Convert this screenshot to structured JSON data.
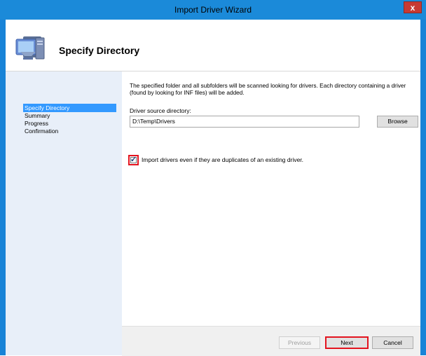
{
  "window": {
    "title": "Import Driver Wizard",
    "close_label": "x"
  },
  "header": {
    "title": "Specify Directory",
    "icon": "computer-monitor-icon"
  },
  "sidebar": {
    "items": [
      {
        "label": "Specify Directory",
        "active": true
      },
      {
        "label": "Summary",
        "active": false
      },
      {
        "label": "Progress",
        "active": false
      },
      {
        "label": "Confirmation",
        "active": false
      }
    ]
  },
  "main": {
    "description": "The specified folder and all subfolders will be scanned looking for drivers.  Each directory containing a driver (found by looking for INF files) will be added.",
    "source_label": "Driver source directory:",
    "source_value": "D:\\Temp\\Drivers",
    "browse_label": "Browse",
    "duplicate_checkbox_label": "Import drivers even if they are duplicates of an existing driver.",
    "duplicate_checked": true
  },
  "footer": {
    "previous_label": "Previous",
    "next_label": "Next",
    "cancel_label": "Cancel"
  },
  "colors": {
    "titlebar": "#1b8ad9",
    "sidebar_bg": "#e8eff9",
    "selection": "#3399ff",
    "highlight": "#e3141f"
  }
}
